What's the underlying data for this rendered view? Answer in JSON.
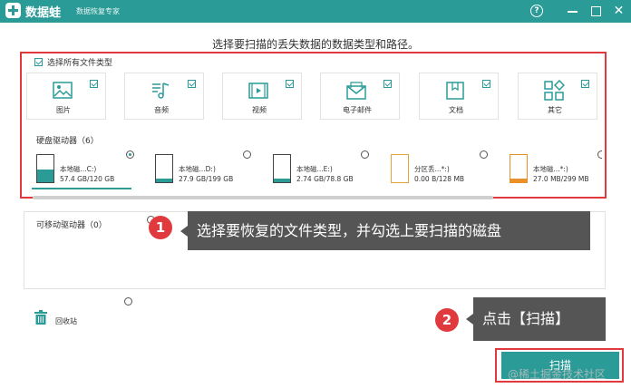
{
  "titlebar": {
    "brand": "数据蛙",
    "subtitle": "数据恢复专家",
    "help": "?",
    "close": "✕"
  },
  "heading": "选择要扫描的丢失数据的数据类型和路径。",
  "select_all": {
    "label": "选择所有文件类型",
    "checked": true
  },
  "file_types": [
    {
      "label": "图片",
      "icon": "image-icon",
      "checked": true
    },
    {
      "label": "音频",
      "icon": "music-icon",
      "checked": true
    },
    {
      "label": "视频",
      "icon": "video-icon",
      "checked": true
    },
    {
      "label": "电子邮件",
      "icon": "mail-icon",
      "checked": true
    },
    {
      "label": "文档",
      "icon": "document-icon",
      "checked": true
    },
    {
      "label": "其它",
      "icon": "other-icon",
      "checked": true
    }
  ],
  "hard_drives": {
    "title": "硬盘驱动器（6）",
    "items": [
      {
        "name": "本地磁...C:)",
        "size": "57.4 GB/120 GB",
        "selected": true,
        "used_fraction": 0.48,
        "color": "#2a9b97"
      },
      {
        "name": "本地磁...D:)",
        "size": "27.9 GB/199 GB",
        "selected": false,
        "used_fraction": 0.14,
        "color": "#2a9b97"
      },
      {
        "name": "本地磁...E:)",
        "size": "2.74 GB/78.8 GB",
        "selected": false,
        "used_fraction": 0.035,
        "color": "#2a9b97"
      },
      {
        "name": "分区丢...*:)",
        "size": "0.00  B/128 MB",
        "selected": false,
        "used_fraction": 0.0,
        "color": "#e8a23a"
      },
      {
        "name": "本地磁...*:)",
        "size": "27.0 MB/299 MB",
        "selected": false,
        "used_fraction": 0.09,
        "color": "#e8912a"
      }
    ]
  },
  "removable": {
    "title": "可移动驱动器（0）"
  },
  "recycle_bin": {
    "label": "回收站"
  },
  "tips": [
    {
      "number": "1",
      "text": "选择要恢复的文件类型，并勾选上要扫描的磁盘"
    },
    {
      "number": "2",
      "text": "点击【扫描】"
    }
  ],
  "scan_button": "扫描",
  "watermark": "@稀土掘金技术社区",
  "colors": {
    "accent": "#2a9b97",
    "highlight": "#e0393e",
    "tooltip": "#555555"
  }
}
